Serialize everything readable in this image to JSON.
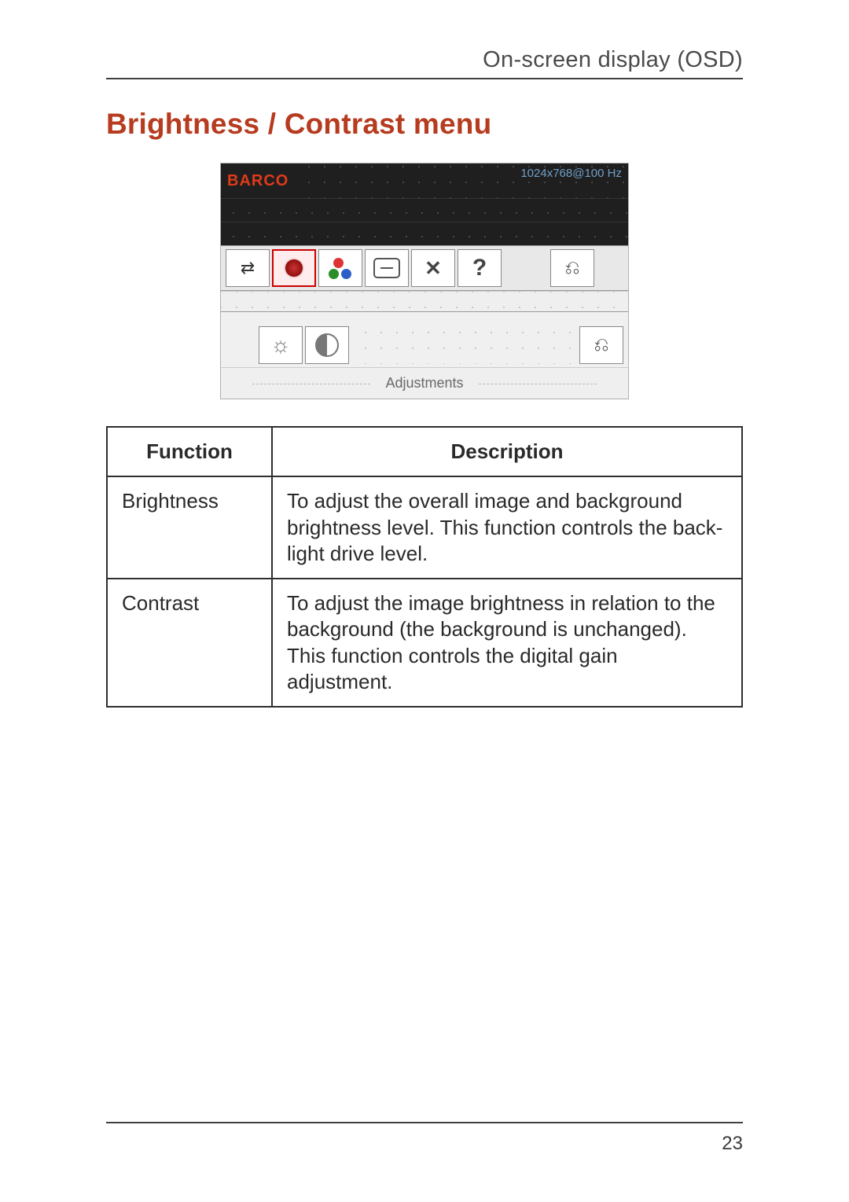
{
  "header": {
    "section": "On-screen display (OSD)"
  },
  "title": "Brightness / Contrast menu",
  "osd": {
    "brand": "BARCO",
    "resolution": "1024x768@100 Hz",
    "row1_icons": [
      {
        "name": "autoset-icon",
        "sel": false
      },
      {
        "name": "brightness-contrast-icon",
        "sel": true
      },
      {
        "name": "color-icon",
        "sel": false
      },
      {
        "name": "geometry-icon",
        "sel": false
      },
      {
        "name": "tools-icon",
        "sel": false
      },
      {
        "name": "help-icon",
        "sel": false
      },
      {
        "name": "gap",
        "sel": false
      },
      {
        "name": "exit-icon",
        "sel": false
      }
    ],
    "row2_icons": [
      {
        "name": "brightness-icon"
      },
      {
        "name": "contrast-icon"
      },
      {
        "name": "exit-icon"
      }
    ],
    "label": "Adjustments"
  },
  "table": {
    "headers": {
      "fn": "Function",
      "desc": "Description"
    },
    "rows": [
      {
        "fn": "Brightness",
        "desc": "To adjust the overall image and background brightness level. This function controls the back-light drive level."
      },
      {
        "fn": "Contrast",
        "desc": "To adjust the image brightness in relation to the background  (the background is unchanged). This function controls the digital gain adjustment."
      }
    ]
  },
  "page_number": "23"
}
